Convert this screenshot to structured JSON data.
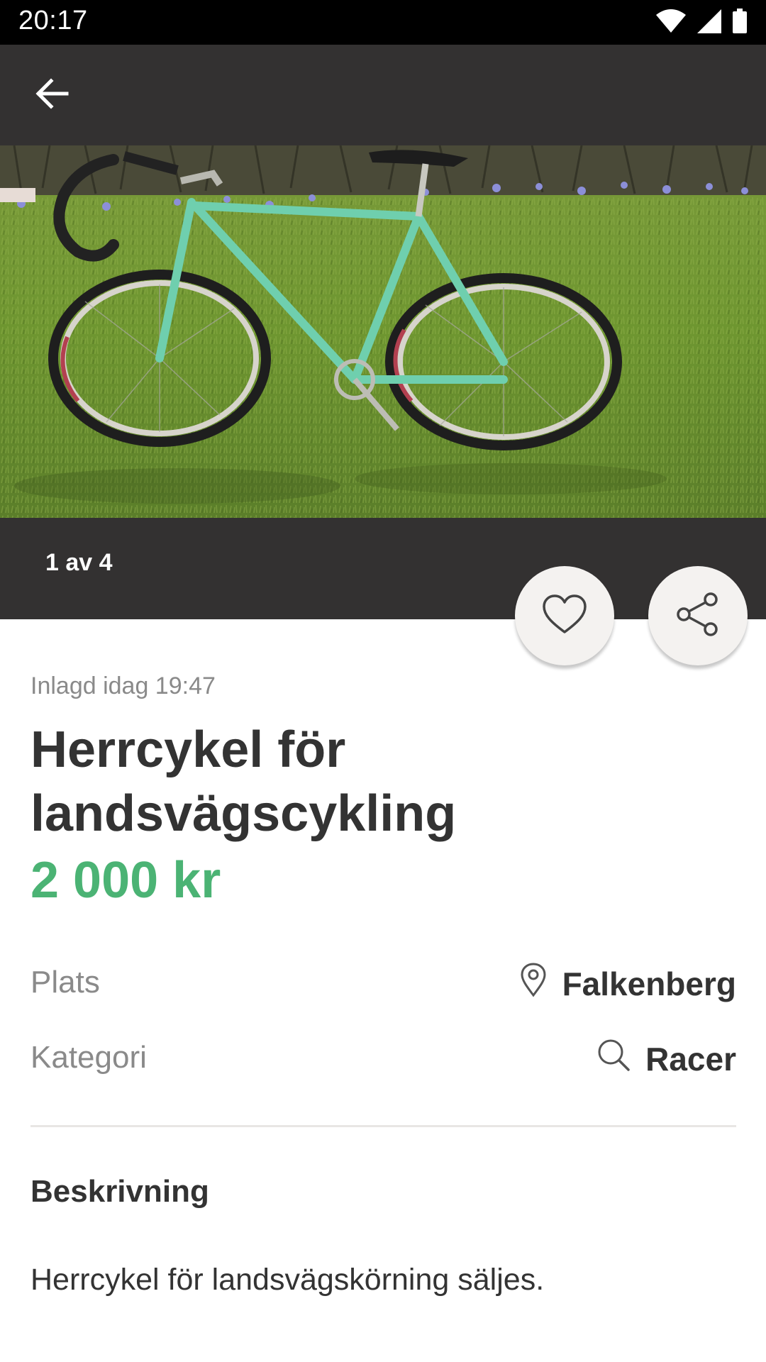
{
  "status_bar": {
    "time": "20:17",
    "icons": [
      "wifi-icon",
      "signal-icon",
      "battery-icon"
    ]
  },
  "app_bar": {
    "back_icon": "arrow-left-icon"
  },
  "gallery": {
    "counter": "1 av 4"
  },
  "actions": {
    "favorite_icon": "heart-icon",
    "share_icon": "share-icon"
  },
  "listing": {
    "posted": "Inlagd idag 19:47",
    "title": "Herrcykel för landsvägscykling",
    "price": "2 000 kr",
    "place_label": "Plats",
    "place_value": "Falkenberg",
    "category_label": "Kategori",
    "category_value": "Racer",
    "description_heading": "Beskrivning",
    "description": "Herrcykel för landsvägskörning säljes."
  },
  "colors": {
    "app_bar": "#333131",
    "price": "#4bb374",
    "text": "#333333",
    "muted": "#8a8a8a"
  }
}
